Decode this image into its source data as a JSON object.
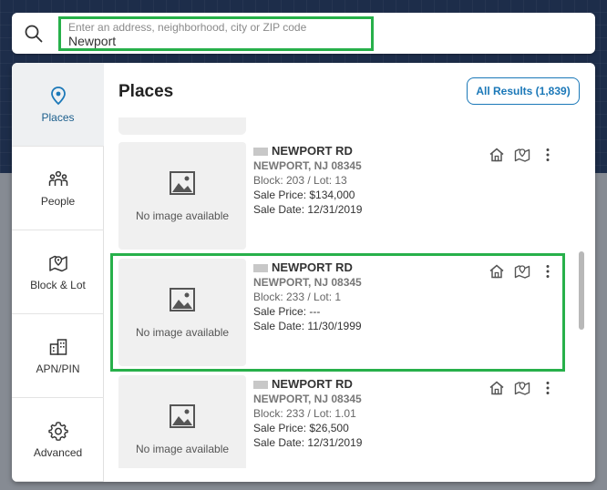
{
  "search": {
    "placeholder": "Enter an address, neighborhood, city or ZIP code",
    "value": "Newport"
  },
  "sidebar": {
    "items": [
      {
        "label": "Places",
        "icon": "location-pin-icon",
        "active": true
      },
      {
        "label": "People",
        "icon": "people-icon",
        "active": false
      },
      {
        "label": "Block & Lot",
        "icon": "map-pin-icon",
        "active": false
      },
      {
        "label": "APN/PIN",
        "icon": "buildings-icon",
        "active": false
      },
      {
        "label": "Advanced",
        "icon": "gear-icon",
        "active": false
      }
    ]
  },
  "main": {
    "title": "Places",
    "all_results_label": "All Results (1,839)"
  },
  "results": [
    {
      "street": "NEWPORT RD",
      "city": "NEWPORT, NJ 08345",
      "block_lot": "Block: 203 / Lot: 13",
      "sale_price": "Sale Price: $134,000",
      "sale_date": "Sale Date: 12/31/2019",
      "no_image": "No image available"
    },
    {
      "street": "NEWPORT RD",
      "city": "NEWPORT, NJ 08345",
      "block_lot": "Block: 233 / Lot: 1",
      "sale_price": "Sale Price: ---",
      "sale_date": "Sale Date: 11/30/1999",
      "no_image": "No image available"
    },
    {
      "street": "NEWPORT RD",
      "city": "NEWPORT, NJ 08345",
      "block_lot": "Block: 233 / Lot: 1.01",
      "sale_price": "Sale Price: $26,500",
      "sale_date": "Sale Date: 12/31/2019",
      "no_image": "No image available"
    }
  ],
  "colors": {
    "accent": "#1b78b8",
    "highlight": "#27b04a",
    "active_nav": "#1b5e8c"
  }
}
